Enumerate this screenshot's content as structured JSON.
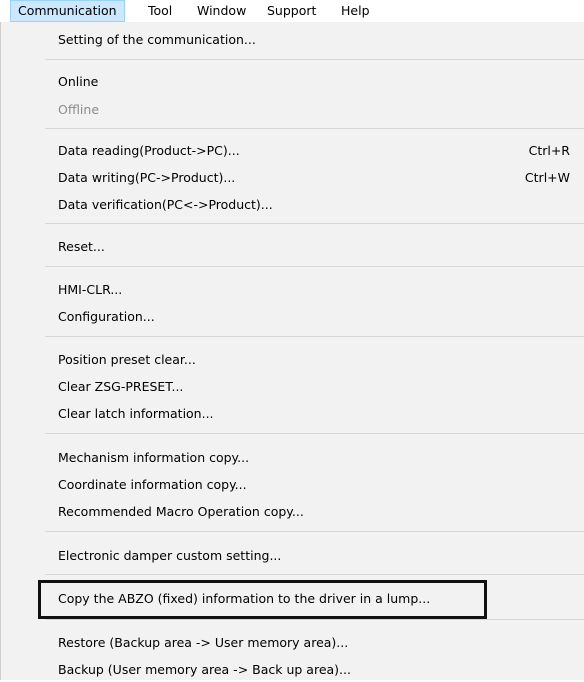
{
  "menubar": {
    "items": [
      "Communication",
      "Tool",
      "Window",
      "Support",
      "Help"
    ]
  },
  "menu": {
    "items": [
      {
        "label": "Setting of the communication..."
      },
      {
        "label": "Online"
      },
      {
        "label": "Offline",
        "disabled": true
      },
      {
        "label": "Data reading(Product->PC)...",
        "shortcut": "Ctrl+R"
      },
      {
        "label": "Data writing(PC->Product)...",
        "shortcut": "Ctrl+W"
      },
      {
        "label": "Data verification(PC<->Product)..."
      },
      {
        "label": "Reset..."
      },
      {
        "label": "HMI-CLR..."
      },
      {
        "label": "Configuration..."
      },
      {
        "label": "Position preset clear..."
      },
      {
        "label": "Clear ZSG-PRESET..."
      },
      {
        "label": "Clear latch information..."
      },
      {
        "label": "Mechanism information copy..."
      },
      {
        "label": "Coordinate information copy..."
      },
      {
        "label": "Recommended Macro Operation copy..."
      },
      {
        "label": "Electronic damper custom setting..."
      },
      {
        "label": "Copy the ABZO (fixed) information to the driver in a lump..."
      },
      {
        "label": "Restore (Backup area -> User memory area)..."
      },
      {
        "label": "Backup (User memory area -> Back up area)..."
      }
    ]
  }
}
